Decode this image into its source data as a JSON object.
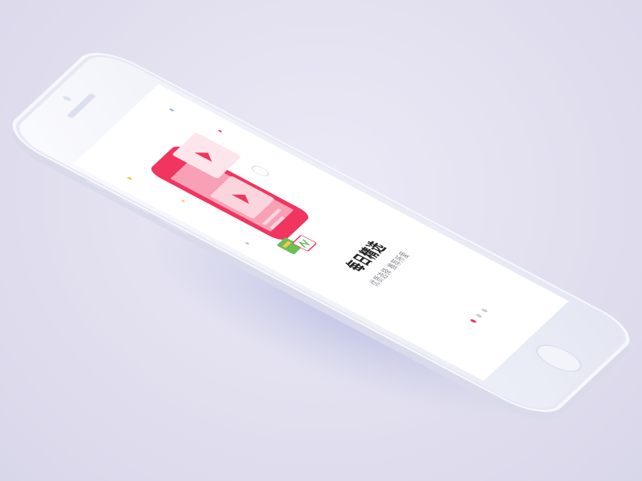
{
  "onboarding": {
    "title": "每日精选",
    "subtitle": "优质选择  推荐所爱",
    "illustration": "video-cards-illustration",
    "pager": {
      "count": 3,
      "active_index": 0
    }
  },
  "colors": {
    "accent": "#f0355e",
    "accent_light": "#f8a1b6",
    "card_pink": "#fbd5de",
    "ticket_green": "#6bbf59",
    "background": "#e6e5f2"
  },
  "icons": {
    "play": "play-icon",
    "ticket": "ticket-icon",
    "coupon": "coupon-icon"
  }
}
